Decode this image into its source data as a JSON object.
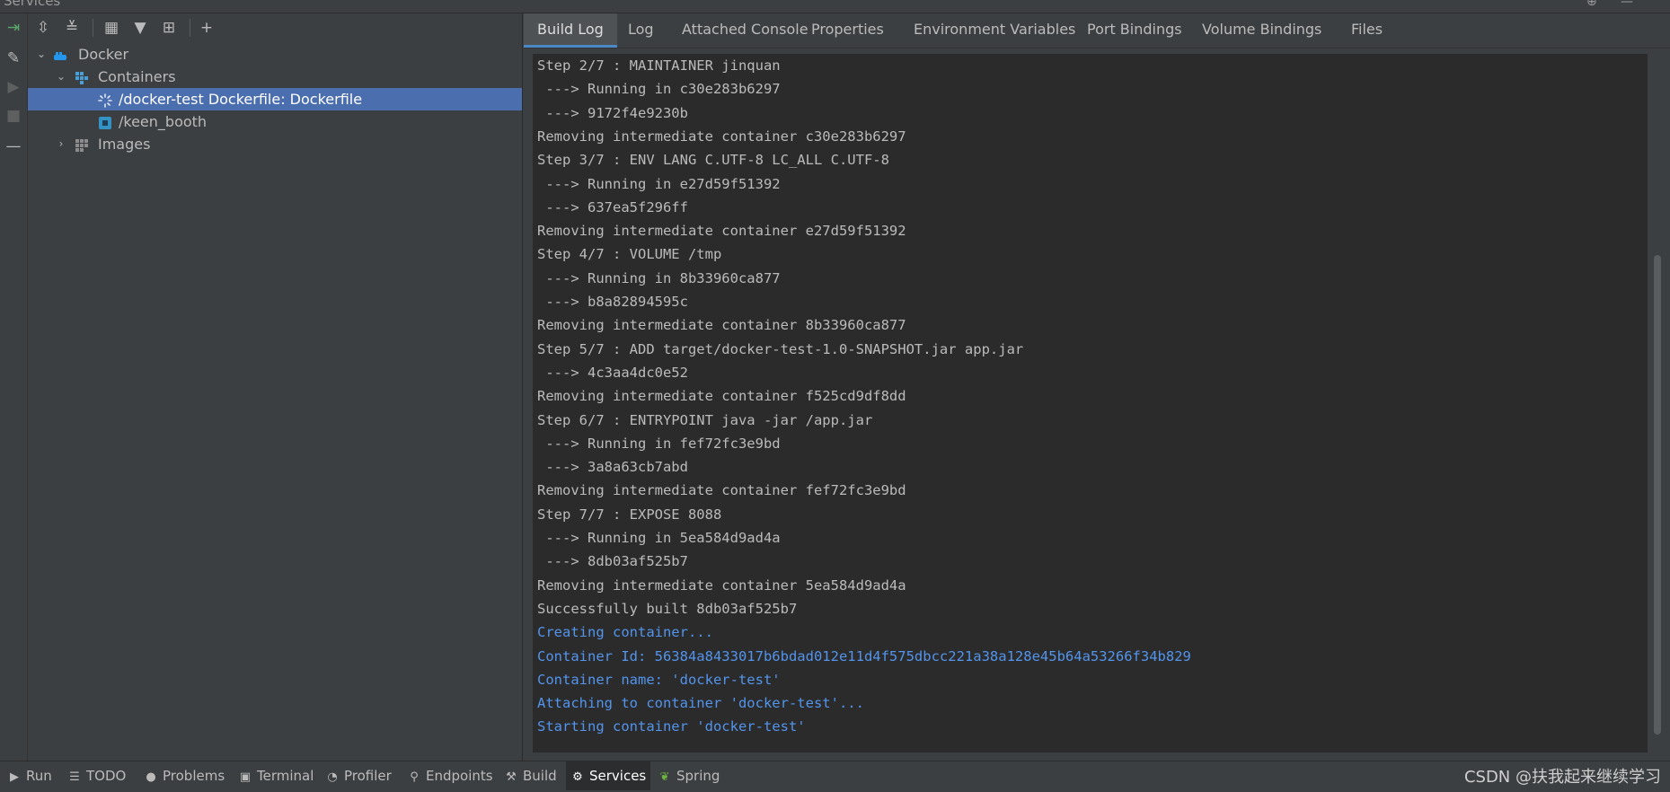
{
  "window": {
    "title": "Services"
  },
  "toolbar": {
    "icons": [
      "expand-all-icon",
      "collapse-all-icon",
      "group-by-icon",
      "filter-icon",
      "new-tab-icon",
      "add-icon"
    ]
  },
  "left_rail": [
    "rerun-icon",
    "edit-icon",
    "run-icon",
    "stop-icon",
    "minimize-icon"
  ],
  "tree": [
    {
      "label": "Docker",
      "level": 1,
      "expanded": true,
      "icon": "docker-icon"
    },
    {
      "label": "Containers",
      "level": 2,
      "expanded": true,
      "icon": "containers-icon"
    },
    {
      "label": "/docker-test Dockerfile: Dockerfile",
      "level": 3,
      "selected": true,
      "icon": "loading-spinner-icon"
    },
    {
      "label": "/keen_booth",
      "level": 3,
      "icon": "container-icon"
    },
    {
      "label": "Images",
      "level": 2,
      "expanded": false,
      "icon": "images-icon"
    }
  ],
  "tabs": [
    {
      "label": "Build Log",
      "active": true
    },
    {
      "label": "Log"
    },
    {
      "label": "Attached Console"
    },
    {
      "label": "Properties"
    },
    {
      "label": "Environment Variables"
    },
    {
      "label": "Port Bindings"
    },
    {
      "label": "Volume Bindings"
    },
    {
      "label": "Files"
    }
  ],
  "log": [
    {
      "text": "Step 2/7 : MAINTAINER jinquan",
      "kind": "normal"
    },
    {
      "text": " ---> Running in c30e283b6297",
      "kind": "normal"
    },
    {
      "text": " ---> 9172f4e9230b",
      "kind": "normal"
    },
    {
      "text": "Removing intermediate container c30e283b6297",
      "kind": "normal"
    },
    {
      "text": "Step 3/7 : ENV LANG C.UTF-8 LC_ALL C.UTF-8",
      "kind": "normal"
    },
    {
      "text": " ---> Running in e27d59f51392",
      "kind": "normal"
    },
    {
      "text": " ---> 637ea5f296ff",
      "kind": "normal"
    },
    {
      "text": "Removing intermediate container e27d59f51392",
      "kind": "normal"
    },
    {
      "text": "Step 4/7 : VOLUME /tmp",
      "kind": "normal"
    },
    {
      "text": " ---> Running in 8b33960ca877",
      "kind": "normal"
    },
    {
      "text": " ---> b8a82894595c",
      "kind": "normal"
    },
    {
      "text": "Removing intermediate container 8b33960ca877",
      "kind": "normal"
    },
    {
      "text": "Step 5/7 : ADD target/docker-test-1.0-SNAPSHOT.jar app.jar",
      "kind": "normal"
    },
    {
      "text": " ---> 4c3aa4dc0e52",
      "kind": "normal"
    },
    {
      "text": "Removing intermediate container f525cd9df8dd",
      "kind": "normal"
    },
    {
      "text": "Step 6/7 : ENTRYPOINT java -jar /app.jar",
      "kind": "normal"
    },
    {
      "text": " ---> Running in fef72fc3e9bd",
      "kind": "normal"
    },
    {
      "text": " ---> 3a8a63cb7abd",
      "kind": "normal"
    },
    {
      "text": "Removing intermediate container fef72fc3e9bd",
      "kind": "normal"
    },
    {
      "text": "Step 7/7 : EXPOSE 8088",
      "kind": "normal"
    },
    {
      "text": " ---> Running in 5ea584d9ad4a",
      "kind": "normal"
    },
    {
      "text": " ---> 8db03af525b7",
      "kind": "normal"
    },
    {
      "text": "Removing intermediate container 5ea584d9ad4a",
      "kind": "normal"
    },
    {
      "text": "Successfully built 8db03af525b7",
      "kind": "normal"
    },
    {
      "text": "Creating container...",
      "kind": "info"
    },
    {
      "text": "Container Id: 56384a8433017b6bdad012e11d4f575dbcc221a38a128e45b64a53266f34b829",
      "kind": "info"
    },
    {
      "text": "Container name: 'docker-test'",
      "kind": "info"
    },
    {
      "text": "Attaching to container 'docker-test'...",
      "kind": "info"
    },
    {
      "text": "Starting container 'docker-test'",
      "kind": "info"
    }
  ],
  "statusbar": [
    {
      "label": "Run",
      "icon": "run-icon"
    },
    {
      "label": "TODO",
      "icon": "todo-icon"
    },
    {
      "label": "Problems",
      "icon": "problems-icon"
    },
    {
      "label": "Terminal",
      "icon": "terminal-icon"
    },
    {
      "label": "Profiler",
      "icon": "profiler-icon"
    },
    {
      "label": "Endpoints",
      "icon": "endpoints-icon"
    },
    {
      "label": "Build",
      "icon": "build-icon"
    },
    {
      "label": "Services",
      "icon": "services-icon",
      "active": true
    },
    {
      "label": "Spring",
      "icon": "spring-icon"
    }
  ],
  "watermark": "CSDN @扶我起来继续学习",
  "colors": {
    "selection": "#4b6eaf",
    "info_text": "#5394ec",
    "console_bg": "#2b2b2b",
    "panel_bg": "#3c3f41",
    "accent": "#4a88c7"
  }
}
